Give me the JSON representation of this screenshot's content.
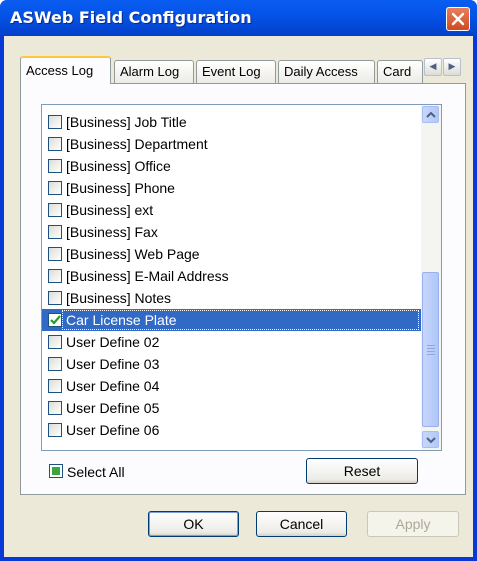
{
  "window": {
    "title": "ASWeb Field Configuration",
    "close_icon": "close-icon"
  },
  "tabs": [
    {
      "label": "Access Log",
      "active": true
    },
    {
      "label": "Alarm Log",
      "active": false
    },
    {
      "label": "Event Log",
      "active": false
    },
    {
      "label": "Daily Access",
      "active": false
    },
    {
      "label": "Card",
      "active": false
    }
  ],
  "tab_scroll": {
    "left_icon": "arrow-left-icon",
    "right_icon": "arrow-right-icon"
  },
  "fields": [
    {
      "label": "[Business] Job Title",
      "checked": false,
      "selected": false
    },
    {
      "label": "[Business] Department",
      "checked": false,
      "selected": false
    },
    {
      "label": "[Business] Office",
      "checked": false,
      "selected": false
    },
    {
      "label": "[Business] Phone",
      "checked": false,
      "selected": false
    },
    {
      "label": "[Business] ext",
      "checked": false,
      "selected": false
    },
    {
      "label": "[Business] Fax",
      "checked": false,
      "selected": false
    },
    {
      "label": "[Business] Web Page",
      "checked": false,
      "selected": false
    },
    {
      "label": "[Business] E-Mail Address",
      "checked": false,
      "selected": false
    },
    {
      "label": "[Business] Notes",
      "checked": false,
      "selected": false
    },
    {
      "label": "Car License Plate",
      "checked": true,
      "selected": true
    },
    {
      "label": "User Define 02",
      "checked": false,
      "selected": false
    },
    {
      "label": "User Define 03",
      "checked": false,
      "selected": false
    },
    {
      "label": "User Define 04",
      "checked": false,
      "selected": false
    },
    {
      "label": "User Define 05",
      "checked": false,
      "selected": false
    },
    {
      "label": "User Define 06",
      "checked": false,
      "selected": false
    }
  ],
  "select_all": {
    "label": "Select All",
    "state": "indeterminate"
  },
  "buttons": {
    "reset": "Reset",
    "ok": "OK",
    "cancel": "Cancel",
    "apply": "Apply"
  },
  "colors": {
    "selection": "#316ac5",
    "titlebar": "#0452e6",
    "check": "#21a121",
    "close": "#d14a1f"
  }
}
